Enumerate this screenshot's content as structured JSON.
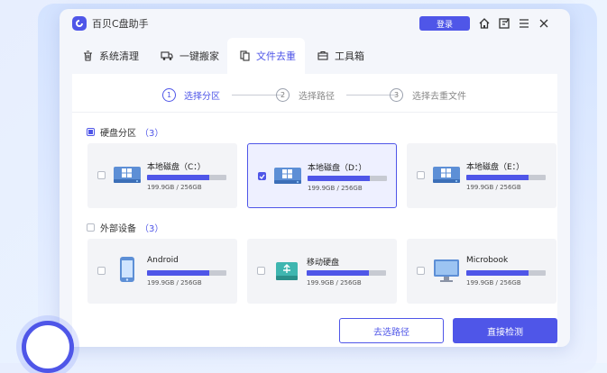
{
  "app": {
    "title": "百贝C盘助手",
    "login_label": "登录"
  },
  "titlebar_icons": [
    "home-icon",
    "feedback-icon",
    "menu-icon",
    "close-icon"
  ],
  "tabs": [
    {
      "label": "系统清理",
      "icon": "trash-icon"
    },
    {
      "label": "一键搬家",
      "icon": "truck-icon"
    },
    {
      "label": "文件去重",
      "icon": "file-copy-icon",
      "active": true
    },
    {
      "label": "工具箱",
      "icon": "toolbox-icon"
    }
  ],
  "steps": [
    {
      "num": "1",
      "label": "选择分区",
      "active": true
    },
    {
      "num": "2",
      "label": "选择路径"
    },
    {
      "num": "3",
      "label": "选择去重文件"
    }
  ],
  "disk_section": {
    "label": "硬盘分区",
    "count": "（3）",
    "state": "partial",
    "items": [
      {
        "name": "本地磁盘（C：）",
        "size": "199.9GB / 256GB",
        "fill": 0.78,
        "checked": false,
        "icon": "windows-drive-icon"
      },
      {
        "name": "本地磁盘（D：）",
        "size": "199.9GB / 256GB",
        "fill": 0.78,
        "checked": true,
        "icon": "windows-drive-icon"
      },
      {
        "name": "本地磁盘（E：）",
        "size": "199.9GB / 256GB",
        "fill": 0.78,
        "checked": false,
        "icon": "windows-drive-icon"
      }
    ]
  },
  "external_section": {
    "label": "外部设备",
    "count": "（3）",
    "state": "unchecked",
    "items": [
      {
        "name": "Android",
        "size": "199.9GB / 256GB",
        "fill": 0.78,
        "checked": false,
        "icon": "phone-icon"
      },
      {
        "name": "移动硬盘",
        "size": "199.9GB / 256GB",
        "fill": 0.78,
        "checked": false,
        "icon": "usb-drive-icon"
      },
      {
        "name": "Microbook",
        "size": "199.9GB / 256GB",
        "fill": 0.78,
        "checked": false,
        "icon": "laptop-icon"
      }
    ]
  },
  "buttons": {
    "choose_path": "去选路径",
    "scan_now": "直接检测"
  },
  "colors": {
    "accent": "#4f56e8",
    "card_bg": "#f3f4f7",
    "selected_bg": "#eef0ff"
  }
}
